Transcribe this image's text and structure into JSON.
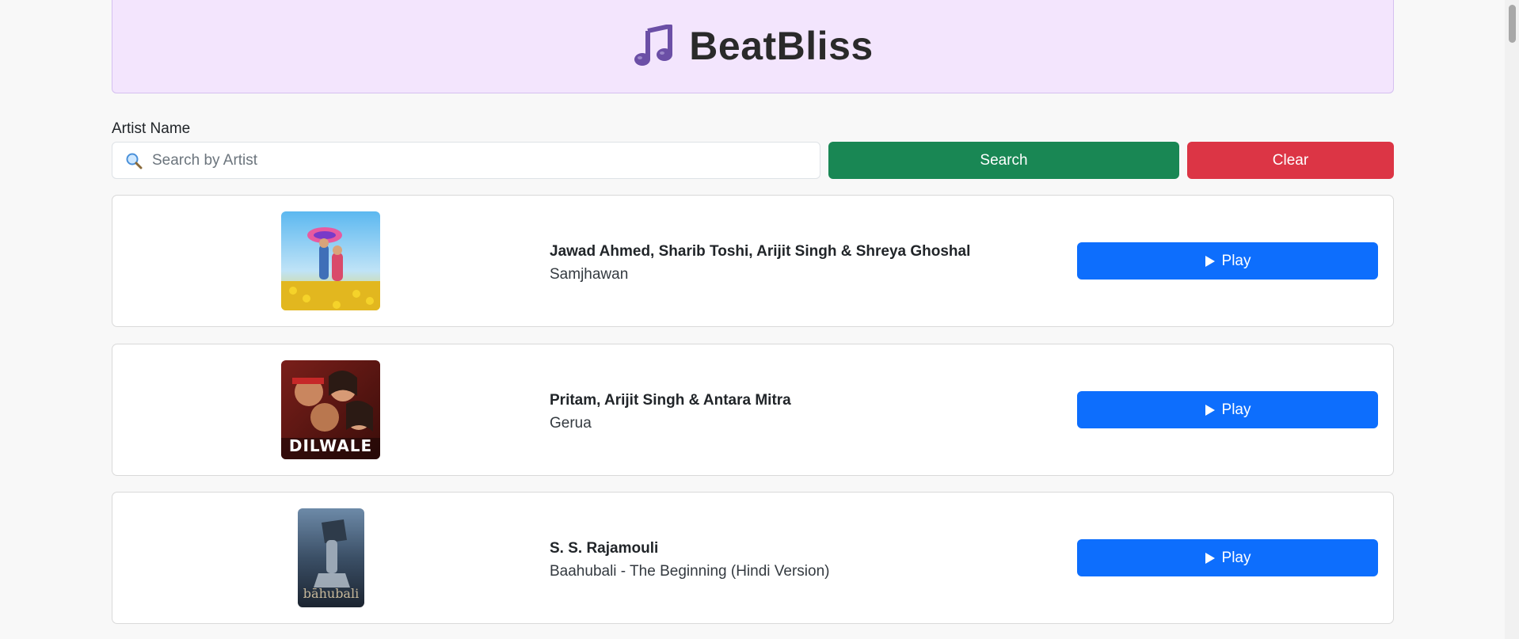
{
  "app": {
    "title": "BeatBliss",
    "logo_icon": "music-note-icon",
    "accent_color": "#7a5fb0"
  },
  "search": {
    "label": "Artist Name",
    "placeholder": "Search by Artist",
    "value": "",
    "search_label": "Search",
    "clear_label": "Clear",
    "search_color": "#198754",
    "clear_color": "#dc3545"
  },
  "songs": [
    {
      "artist": "Jawad Ahmed, Sharib Toshi, Arijit Singh & Shreya Ghoshal",
      "title": "Samjhawan",
      "play_label": "Play"
    },
    {
      "artist": "Pritam, Arijit Singh & Antara Mitra",
      "title": "Gerua",
      "play_label": "Play",
      "cover_text": "DILWALE"
    },
    {
      "artist": "S. S. Rajamouli",
      "title": "Baahubali - The Beginning (Hindi Version)",
      "play_label": "Play",
      "cover_text": "bāhubali"
    }
  ],
  "play_color": "#0d6efd"
}
